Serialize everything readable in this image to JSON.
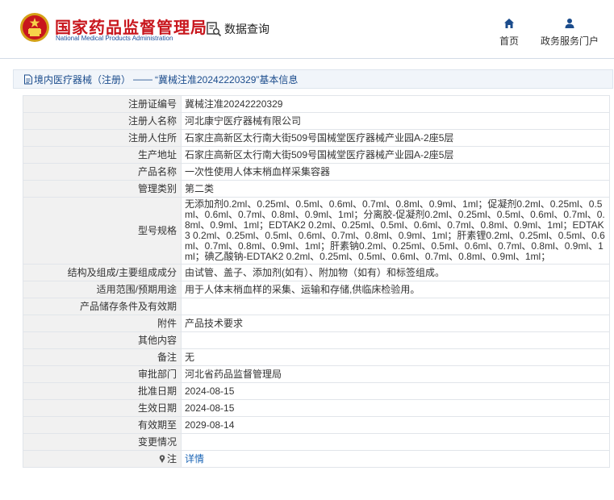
{
  "header": {
    "brand_cn": "国家药品监督管理局",
    "brand_en": "National Medical Products Administration",
    "query_label": "数据查询",
    "nav": {
      "home_label": "首页",
      "portal_label": "政务服务门户"
    }
  },
  "breadcrumb": {
    "section": "境内医疗器械（注册）",
    "separator": "——",
    "current": "“冀械注准20242220329”基本信息"
  },
  "colors": {
    "brand_red": "#c8161d",
    "brand_blue": "#1a4f9c",
    "nav_blue": "#1b4c8c",
    "link_blue": "#1a64b5",
    "label_bg": "#f1f1f1"
  },
  "icons": {
    "emblem": "national-emblem-icon",
    "query": "search-document-icon",
    "home": "home-icon",
    "portal": "user-icon",
    "breadcrumb": "document-icon",
    "note": "info-marker-icon"
  },
  "rows": [
    {
      "label": "注册证编号",
      "value": "冀械注准20242220329"
    },
    {
      "label": "注册人名称",
      "value": "河北康宁医疗器械有限公司"
    },
    {
      "label": "注册人住所",
      "value": "石家庄高新区太行南大街509号国械堂医疗器械产业园A-2座5层"
    },
    {
      "label": "生产地址",
      "value": "石家庄高新区太行南大街509号国械堂医疗器械产业园A-2座5层"
    },
    {
      "label": "产品名称",
      "value": "一次性使用人体末梢血样采集容器"
    },
    {
      "label": "管理类别",
      "value": "第二类"
    },
    {
      "label": "型号规格",
      "value": "无添加剂0.2ml、0.25ml、0.5ml、0.6ml、0.7ml、0.8ml、0.9ml、1ml；促凝剂0.2ml、0.25ml、0.5ml、0.6ml、0.7ml、0.8ml、0.9ml、1ml；分离胶-促凝剂0.2ml、0.25ml、0.5ml、0.6ml、0.7ml、0.8ml、0.9ml、1ml；EDTAK2 0.2ml、0.25ml、0.5ml、0.6ml、0.7ml、0.8ml、0.9ml、1ml；EDTAK3 0.2ml、0.25ml、0.5ml、0.6ml、0.7ml、0.8ml、0.9ml、1ml；肝素锂0.2ml、0.25ml、0.5ml、0.6ml、0.7ml、0.8ml、0.9ml、1ml；肝素钠0.2ml、0.25ml、0.5ml、0.6ml、0.7ml、0.8ml、0.9ml、1ml；碘乙酸钠-EDTAK2 0.2ml、0.25ml、0.5ml、0.6ml、0.7ml、0.8ml、0.9ml、1ml；"
    },
    {
      "label": "结构及组成/主要组成成分",
      "value": "由试管、盖子、添加剂(如有）、附加物（如有）和标签组成。"
    },
    {
      "label": "适用范围/预期用途",
      "value": "用于人体末梢血样的采集、运输和存储,供临床检验用。"
    },
    {
      "label": "产品储存条件及有效期",
      "value": ""
    },
    {
      "label": "附件",
      "value": "产品技术要求"
    },
    {
      "label": "其他内容",
      "value": ""
    },
    {
      "label": "备注",
      "value": "无"
    },
    {
      "label": "审批部门",
      "value": "河北省药品监督管理局"
    },
    {
      "label": "批准日期",
      "value": "2024-08-15"
    },
    {
      "label": "生效日期",
      "value": "2024-08-15"
    },
    {
      "label": "有效期至",
      "value": "2029-08-14"
    },
    {
      "label": "变更情况",
      "value": ""
    },
    {
      "label": "注",
      "value": "详情"
    }
  ]
}
